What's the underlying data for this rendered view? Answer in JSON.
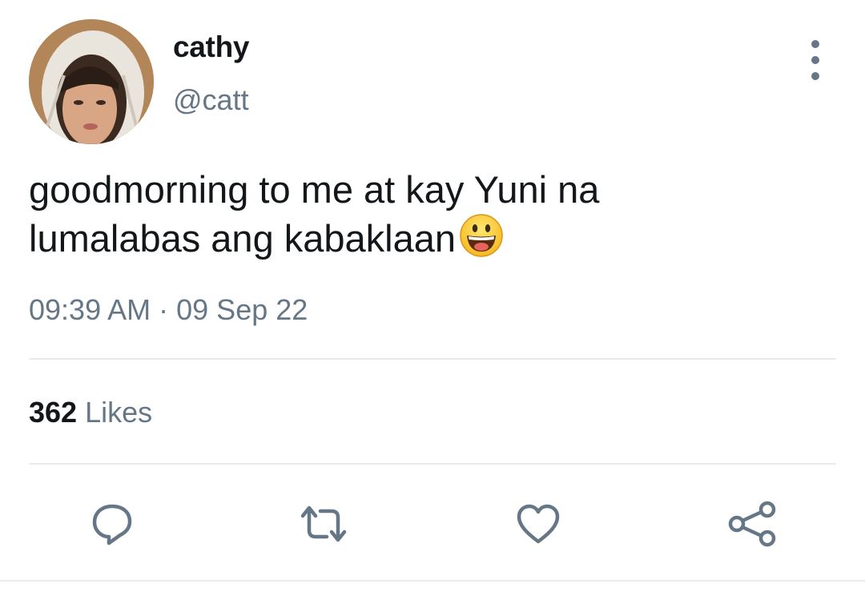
{
  "user": {
    "display_name": "cathy",
    "handle": "@catt",
    "avatar_icon": "profile-photo"
  },
  "menu": {
    "icon": "more-vertical-icon"
  },
  "tweet": {
    "text_line1": "goodmorning to me at kay Yuni na",
    "text_line2": "lumalabas ang kabaklaan",
    "emoji": "grinning-face-emoji",
    "time": "09:39 AM",
    "separator": "·",
    "date": "09 Sep 22"
  },
  "stats": {
    "likes_count": "362",
    "likes_label": "Likes"
  },
  "actions": {
    "reply_icon": "reply-icon",
    "retweet_icon": "retweet-icon",
    "like_icon": "heart-icon",
    "share_icon": "share-icon"
  },
  "colors": {
    "text_primary": "#14171a",
    "text_secondary": "#657786",
    "divider": "#e6ecf0"
  }
}
